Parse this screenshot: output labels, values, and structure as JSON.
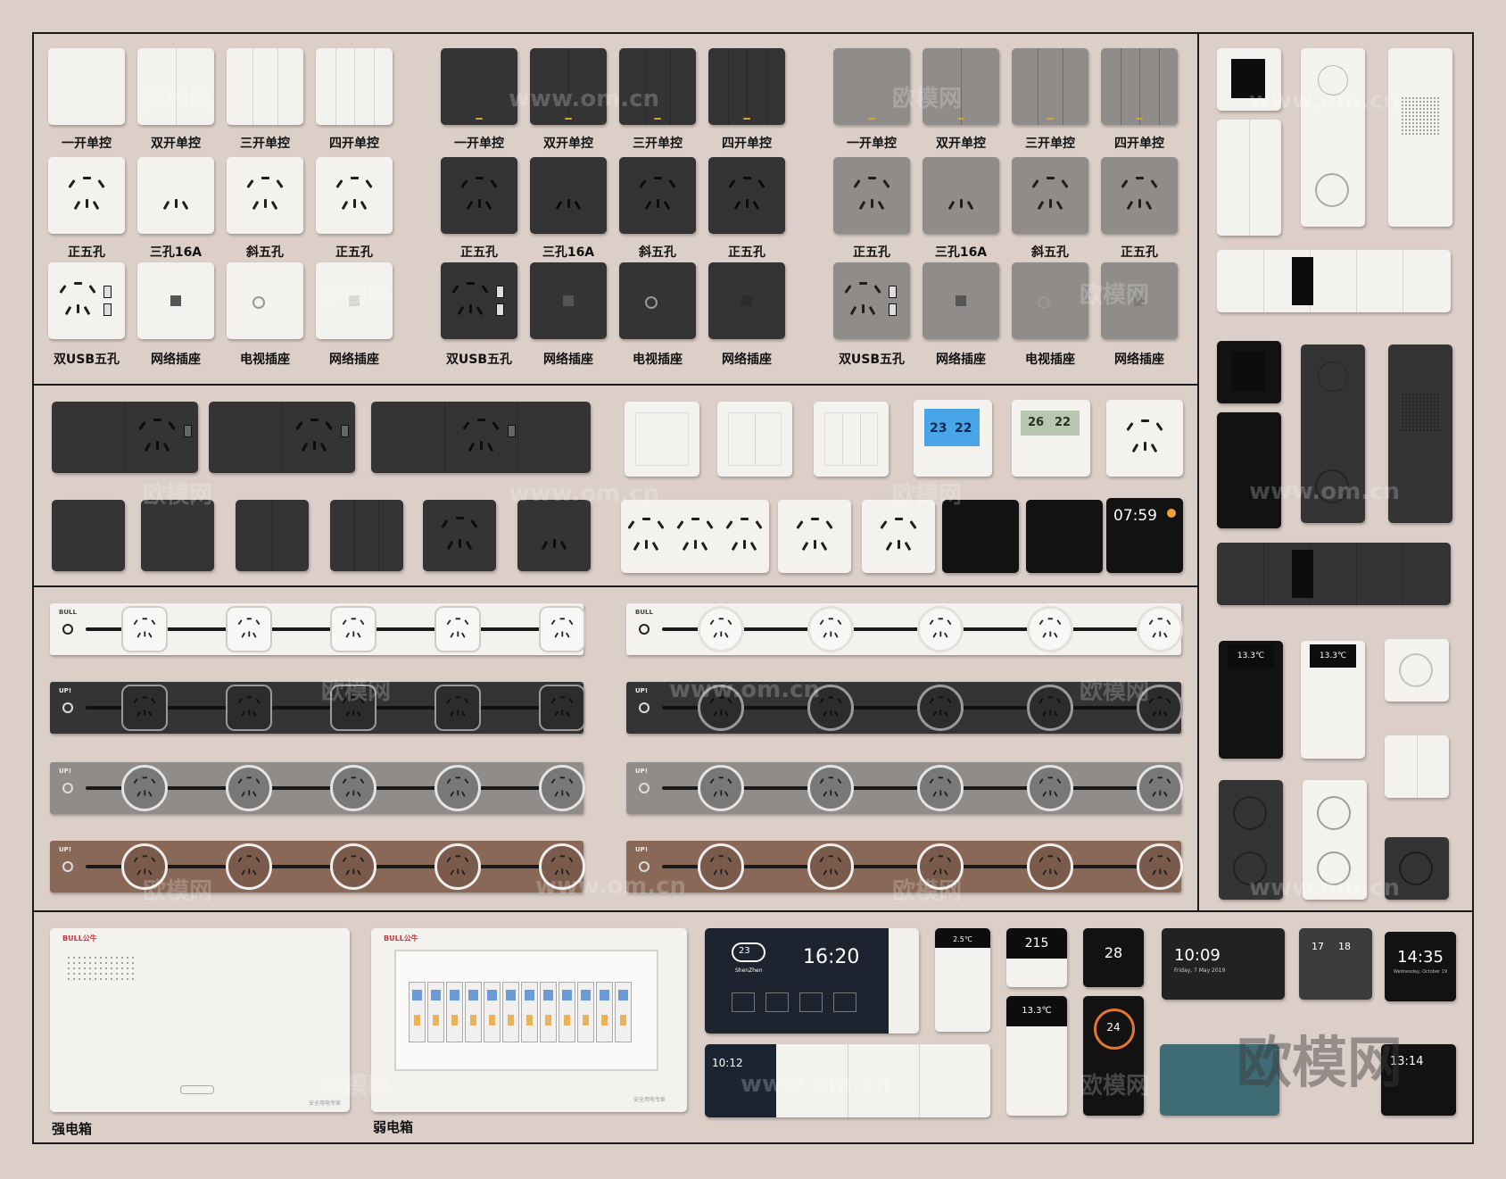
{
  "switch_labels": [
    "一开单控",
    "双开单控",
    "三开单控",
    "四开单控"
  ],
  "socket_labels": [
    "正五孔",
    "三孔16A",
    "斜五孔",
    "正五孔"
  ],
  "special_labels": [
    "双USB五孔",
    "网络插座",
    "电视插座",
    "网络插座"
  ],
  "finishes": [
    "white",
    "dark",
    "gray"
  ],
  "thermostat_1": {
    "left": "23",
    "right": "22"
  },
  "thermostat_2": {
    "left": "26",
    "right": "22"
  },
  "smart_panel_time": "07:59",
  "strip_brand": "BULL",
  "strip_model": "UP!",
  "compact_display": "2.5℃",
  "display_row3": "13.3℃",
  "boxes": {
    "strong_label": "强电箱",
    "weak_label": "弱电箱",
    "brand": "BULL公牛",
    "footer": "安全用电专家"
  },
  "screens": {
    "main_time": "16:20",
    "main_temp": "23",
    "main_city": "ShenZhen",
    "main_tiles": [
      "Smart light",
      "Smart fan",
      "Smart TV",
      "Smart curtain"
    ],
    "lower_time": "10:12",
    "small_temp": "215",
    "small_num": "28",
    "small_dial": "24",
    "s6_time": "10:09",
    "s6_date": "Friday, 7 May 2019",
    "s7_a": "17",
    "s7_b": "18",
    "s8_time": "14:35",
    "s8_date": "Wednesday, October 19",
    "s9_time": "13:14"
  },
  "watermarks": [
    "欧模网",
    "www.om.cn"
  ],
  "watermark_big": "欧模网"
}
